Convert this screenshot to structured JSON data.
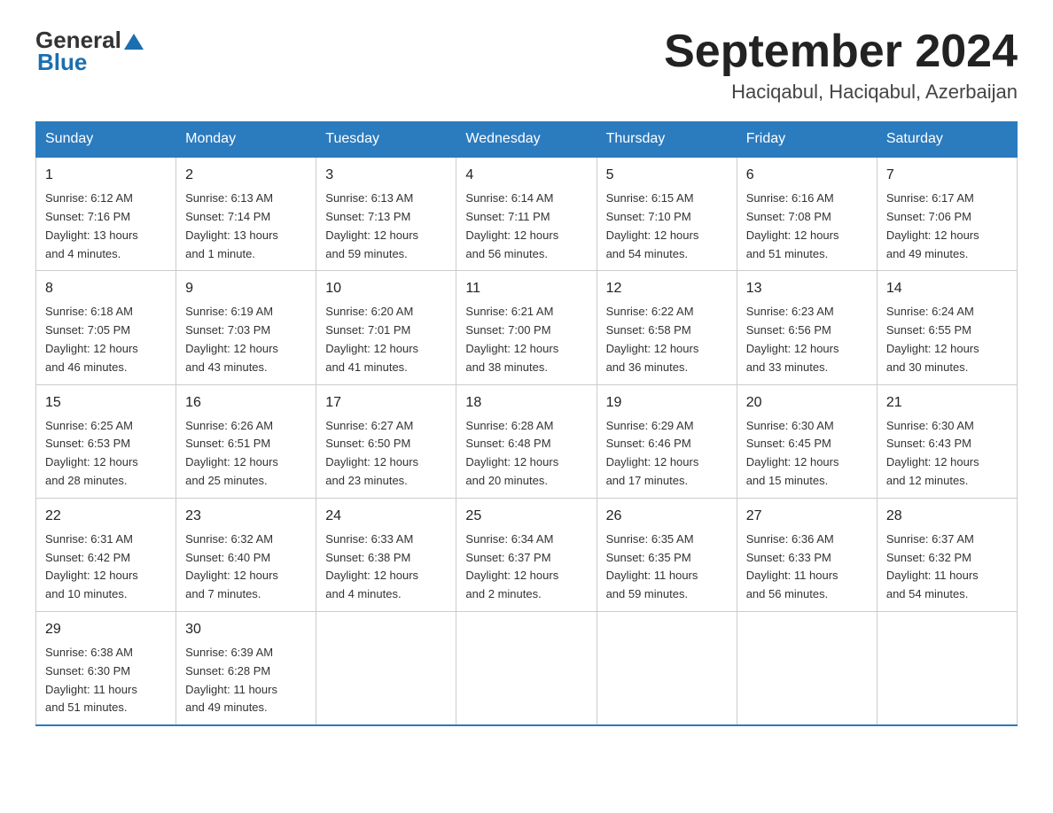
{
  "header": {
    "logo_general": "General",
    "logo_blue": "Blue",
    "month_title": "September 2024",
    "location": "Haciqabul, Haciqabul, Azerbaijan"
  },
  "days_of_week": [
    "Sunday",
    "Monday",
    "Tuesday",
    "Wednesday",
    "Thursday",
    "Friday",
    "Saturday"
  ],
  "weeks": [
    [
      {
        "day": "1",
        "info": "Sunrise: 6:12 AM\nSunset: 7:16 PM\nDaylight: 13 hours\nand 4 minutes."
      },
      {
        "day": "2",
        "info": "Sunrise: 6:13 AM\nSunset: 7:14 PM\nDaylight: 13 hours\nand 1 minute."
      },
      {
        "day": "3",
        "info": "Sunrise: 6:13 AM\nSunset: 7:13 PM\nDaylight: 12 hours\nand 59 minutes."
      },
      {
        "day": "4",
        "info": "Sunrise: 6:14 AM\nSunset: 7:11 PM\nDaylight: 12 hours\nand 56 minutes."
      },
      {
        "day": "5",
        "info": "Sunrise: 6:15 AM\nSunset: 7:10 PM\nDaylight: 12 hours\nand 54 minutes."
      },
      {
        "day": "6",
        "info": "Sunrise: 6:16 AM\nSunset: 7:08 PM\nDaylight: 12 hours\nand 51 minutes."
      },
      {
        "day": "7",
        "info": "Sunrise: 6:17 AM\nSunset: 7:06 PM\nDaylight: 12 hours\nand 49 minutes."
      }
    ],
    [
      {
        "day": "8",
        "info": "Sunrise: 6:18 AM\nSunset: 7:05 PM\nDaylight: 12 hours\nand 46 minutes."
      },
      {
        "day": "9",
        "info": "Sunrise: 6:19 AM\nSunset: 7:03 PM\nDaylight: 12 hours\nand 43 minutes."
      },
      {
        "day": "10",
        "info": "Sunrise: 6:20 AM\nSunset: 7:01 PM\nDaylight: 12 hours\nand 41 minutes."
      },
      {
        "day": "11",
        "info": "Sunrise: 6:21 AM\nSunset: 7:00 PM\nDaylight: 12 hours\nand 38 minutes."
      },
      {
        "day": "12",
        "info": "Sunrise: 6:22 AM\nSunset: 6:58 PM\nDaylight: 12 hours\nand 36 minutes."
      },
      {
        "day": "13",
        "info": "Sunrise: 6:23 AM\nSunset: 6:56 PM\nDaylight: 12 hours\nand 33 minutes."
      },
      {
        "day": "14",
        "info": "Sunrise: 6:24 AM\nSunset: 6:55 PM\nDaylight: 12 hours\nand 30 minutes."
      }
    ],
    [
      {
        "day": "15",
        "info": "Sunrise: 6:25 AM\nSunset: 6:53 PM\nDaylight: 12 hours\nand 28 minutes."
      },
      {
        "day": "16",
        "info": "Sunrise: 6:26 AM\nSunset: 6:51 PM\nDaylight: 12 hours\nand 25 minutes."
      },
      {
        "day": "17",
        "info": "Sunrise: 6:27 AM\nSunset: 6:50 PM\nDaylight: 12 hours\nand 23 minutes."
      },
      {
        "day": "18",
        "info": "Sunrise: 6:28 AM\nSunset: 6:48 PM\nDaylight: 12 hours\nand 20 minutes."
      },
      {
        "day": "19",
        "info": "Sunrise: 6:29 AM\nSunset: 6:46 PM\nDaylight: 12 hours\nand 17 minutes."
      },
      {
        "day": "20",
        "info": "Sunrise: 6:30 AM\nSunset: 6:45 PM\nDaylight: 12 hours\nand 15 minutes."
      },
      {
        "day": "21",
        "info": "Sunrise: 6:30 AM\nSunset: 6:43 PM\nDaylight: 12 hours\nand 12 minutes."
      }
    ],
    [
      {
        "day": "22",
        "info": "Sunrise: 6:31 AM\nSunset: 6:42 PM\nDaylight: 12 hours\nand 10 minutes."
      },
      {
        "day": "23",
        "info": "Sunrise: 6:32 AM\nSunset: 6:40 PM\nDaylight: 12 hours\nand 7 minutes."
      },
      {
        "day": "24",
        "info": "Sunrise: 6:33 AM\nSunset: 6:38 PM\nDaylight: 12 hours\nand 4 minutes."
      },
      {
        "day": "25",
        "info": "Sunrise: 6:34 AM\nSunset: 6:37 PM\nDaylight: 12 hours\nand 2 minutes."
      },
      {
        "day": "26",
        "info": "Sunrise: 6:35 AM\nSunset: 6:35 PM\nDaylight: 11 hours\nand 59 minutes."
      },
      {
        "day": "27",
        "info": "Sunrise: 6:36 AM\nSunset: 6:33 PM\nDaylight: 11 hours\nand 56 minutes."
      },
      {
        "day": "28",
        "info": "Sunrise: 6:37 AM\nSunset: 6:32 PM\nDaylight: 11 hours\nand 54 minutes."
      }
    ],
    [
      {
        "day": "29",
        "info": "Sunrise: 6:38 AM\nSunset: 6:30 PM\nDaylight: 11 hours\nand 51 minutes."
      },
      {
        "day": "30",
        "info": "Sunrise: 6:39 AM\nSunset: 6:28 PM\nDaylight: 11 hours\nand 49 minutes."
      },
      {
        "day": "",
        "info": ""
      },
      {
        "day": "",
        "info": ""
      },
      {
        "day": "",
        "info": ""
      },
      {
        "day": "",
        "info": ""
      },
      {
        "day": "",
        "info": ""
      }
    ]
  ]
}
